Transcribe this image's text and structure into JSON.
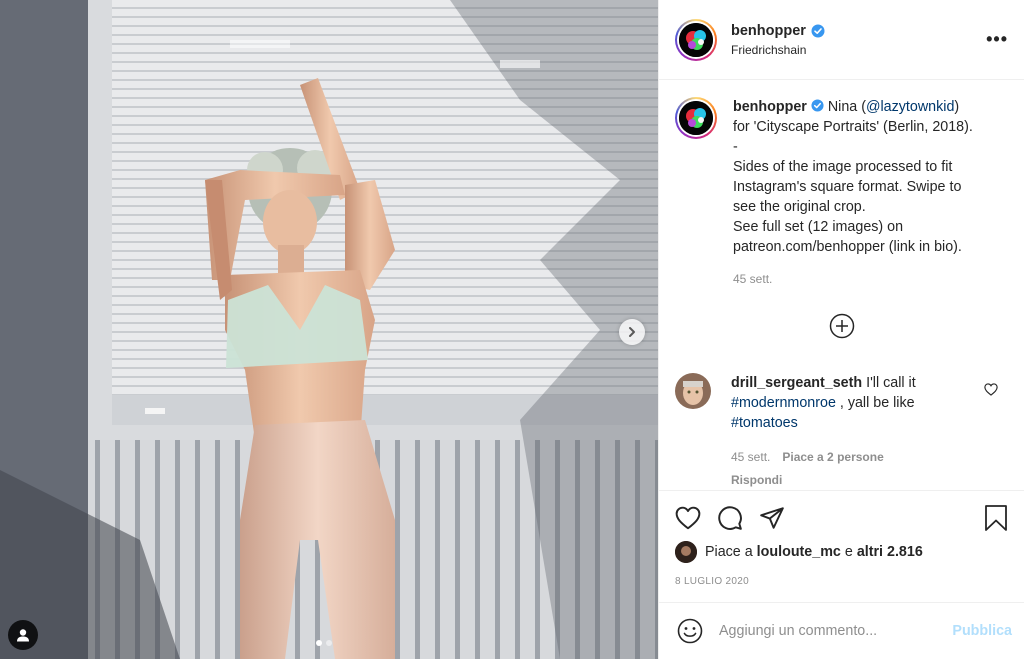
{
  "header": {
    "username": "benhopper",
    "location": "Friedrichshain",
    "more_label": "•••"
  },
  "caption": {
    "username": "benhopper",
    "text_1": "Nina (",
    "mention": "@lazytownkid",
    "text_2": ")",
    "line_2": "for 'Cityscape Portraits' (Berlin, 2018).",
    "line_3": "-",
    "line_4": "Sides of the image processed to fit",
    "line_5": "Instagram's square format. Swipe to",
    "line_6": "see the original crop.",
    "line_7": "See full set (12 images) on",
    "line_8": "patreon.com/benhopper (link in bio).",
    "time": "45 sett."
  },
  "comment": {
    "username": "drill_sergeant_seth",
    "text_1": "I'll call it",
    "hashtag_1": "#modernmonroe",
    "text_2": ", yall be like",
    "hashtag_2": "#tomatoes",
    "time": "45 sett.",
    "likes": "Piace a 2 persone",
    "reply": "Rispondi"
  },
  "likes": {
    "prefix": "Piace a",
    "user": "louloute_mc",
    "middle": "e",
    "others": "altri 2.816"
  },
  "date": "8 LUGLIO 2020",
  "add_comment": {
    "placeholder": "Aggiungi un commento...",
    "publish": "Pubblica"
  },
  "carousel": {
    "total": 2,
    "current": 1
  },
  "colors": {
    "verified": "#3897f0",
    "link": "#00376b",
    "publish_disabled": "#b2dffc"
  }
}
